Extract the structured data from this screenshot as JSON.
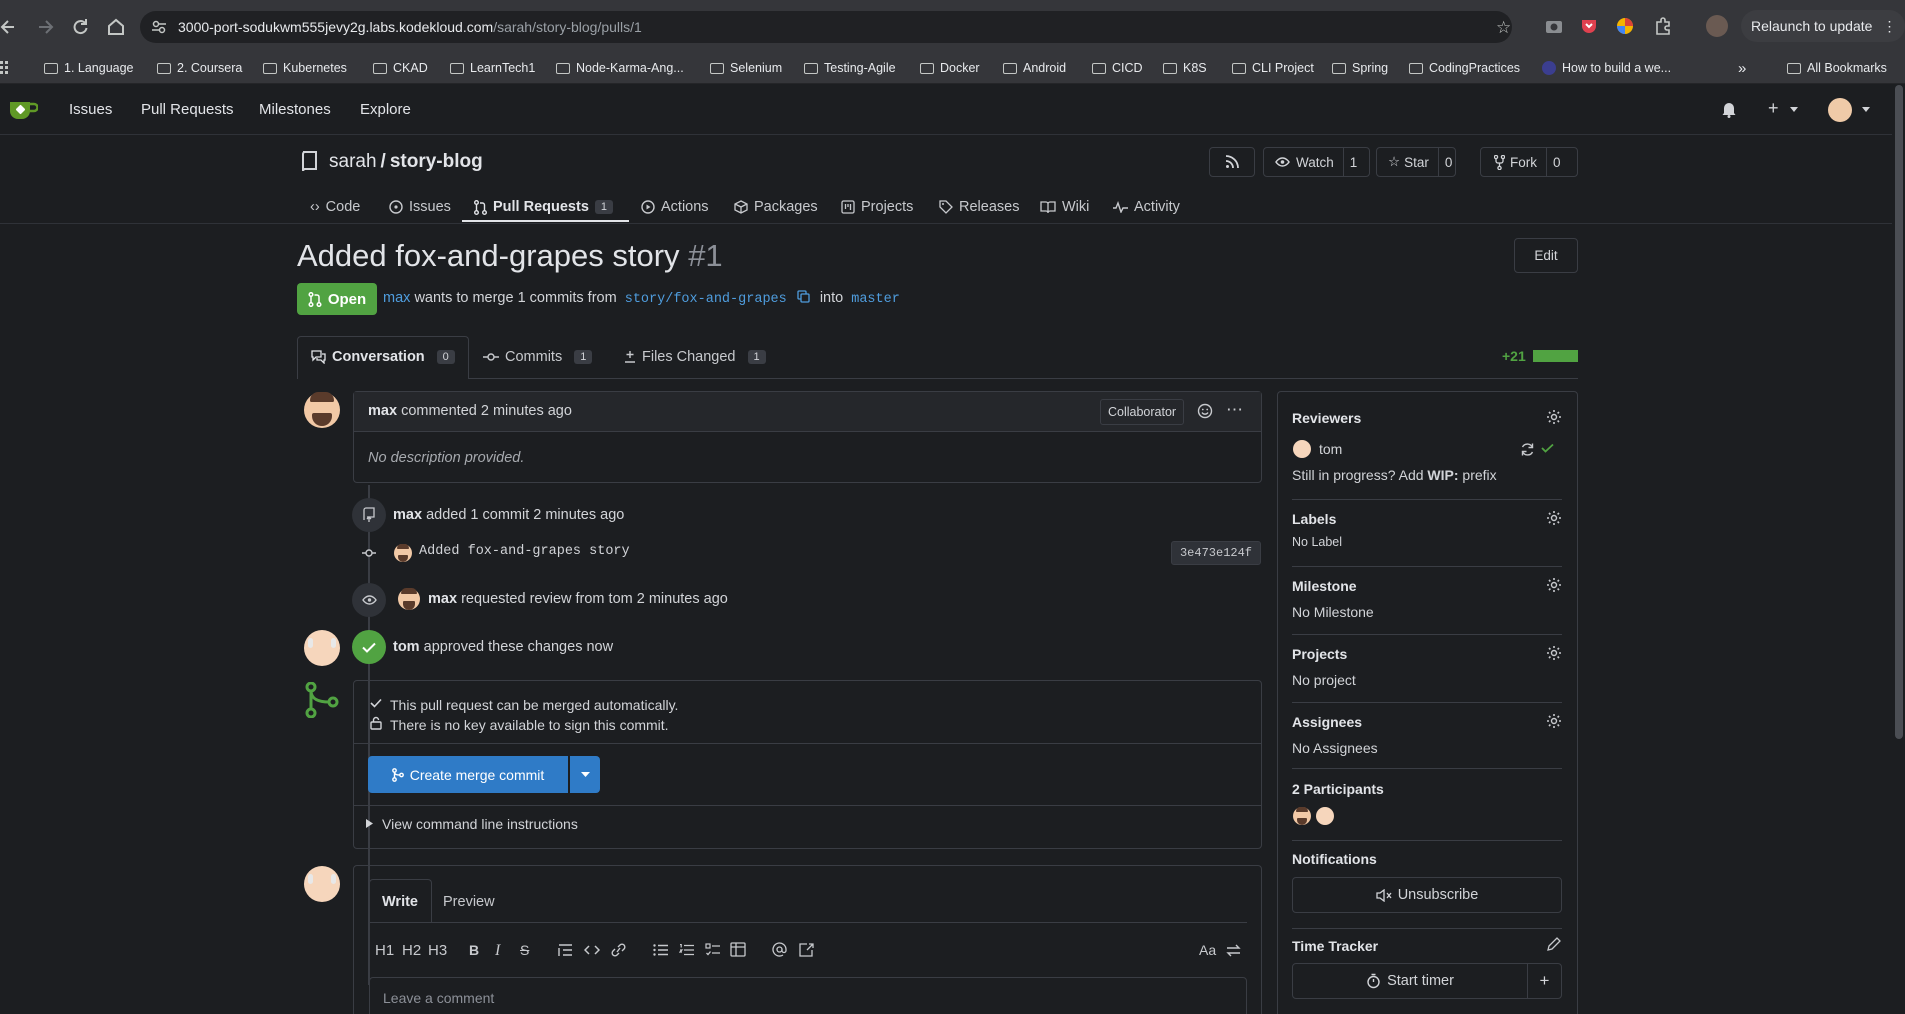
{
  "browser": {
    "url_host": "3000-port-sodukwm555jevy2g.labs.kodekloud.com",
    "url_path": "/sarah/story-blog/pulls/1",
    "relaunch_label": "Relaunch to update",
    "bookmarks": [
      "1. Language",
      "2. Coursera",
      "Kubernetes",
      "CKAD",
      "LearnTech1",
      "Node-Karma-Ang...",
      "Selenium",
      "Testing-Agile",
      "Docker",
      "Android",
      "CICD",
      "K8S",
      "CLI Project",
      "Spring",
      "CodingPractices",
      "How to build a we..."
    ],
    "all_bookmarks": "All Bookmarks",
    "more_bookmarks": "»"
  },
  "nav": {
    "issues": "Issues",
    "pull_requests": "Pull Requests",
    "milestones": "Milestones",
    "explore": "Explore"
  },
  "repo": {
    "owner": "sarah",
    "sep": "/",
    "name": "story-blog",
    "watch_label": "Watch",
    "watch_count": "1",
    "star_label": "Star",
    "star_count": "0",
    "fork_label": "Fork",
    "fork_count": "0",
    "tabs": {
      "code": "Code",
      "issues": "Issues",
      "pull_requests": "Pull Requests",
      "pull_requests_count": "1",
      "actions": "Actions",
      "packages": "Packages",
      "projects": "Projects",
      "releases": "Releases",
      "wiki": "Wiki",
      "activity": "Activity"
    }
  },
  "pr": {
    "title": "Added fox-and-grapes story",
    "number": "#1",
    "edit_label": "Edit",
    "status": "Open",
    "author": "max",
    "merge_text": "wants to merge 1 commits from",
    "from_branch": "story/fox-and-grapes",
    "into_text": "into",
    "to_branch": "master",
    "tabs": {
      "conversation": "Conversation",
      "conversation_count": "0",
      "commits": "Commits",
      "commits_count": "1",
      "files_changed": "Files Changed",
      "files_changed_count": "1"
    },
    "diff_stat": "+21"
  },
  "timeline": {
    "comment": {
      "author": "max",
      "action": "commented 2 minutes ago",
      "role_badge": "Collaborator",
      "body": "No description provided."
    },
    "commit_event": {
      "author": "max",
      "text": "added 1 commit 2 minutes ago"
    },
    "commit": {
      "message": "Added fox-and-grapes story",
      "sha": "3e473e124f"
    },
    "review_request": {
      "author": "max",
      "text": "requested review from tom 2 minutes ago"
    },
    "approval": {
      "author": "tom",
      "text": "approved these changes now"
    },
    "merge_box": {
      "auto_merge": "This pull request can be merged automatically.",
      "no_key": "There is no key available to sign this commit.",
      "merge_button": "Create merge commit",
      "cli_instructions": "View command line instructions"
    }
  },
  "editor": {
    "write_tab": "Write",
    "preview_tab": "Preview",
    "placeholder": "Leave a comment",
    "toolbar": {
      "h1": "H1",
      "h2": "H2",
      "h3": "H3",
      "bold": "B",
      "italic": "I",
      "strike": "S",
      "aa": "Aa"
    }
  },
  "sidebar": {
    "reviewers_title": "Reviewers",
    "reviewer_name": "tom",
    "wip_prefix_text": "Still in progress? Add",
    "wip_bold": "WIP:",
    "wip_suffix": "prefix",
    "labels_title": "Labels",
    "labels_value": "No Label",
    "milestone_title": "Milestone",
    "milestone_value": "No Milestone",
    "projects_title": "Projects",
    "projects_value": "No project",
    "assignees_title": "Assignees",
    "assignees_value": "No Assignees",
    "participants_title": "2 Participants",
    "notifications_title": "Notifications",
    "unsubscribe_label": "Unsubscribe",
    "time_tracker_title": "Time Tracker",
    "start_timer_label": "Start timer"
  },
  "colors": {
    "open_green": "#51a342",
    "link_blue": "#4f9dde",
    "merge_blue": "#2f7bc7",
    "background": "#1c1e21"
  }
}
